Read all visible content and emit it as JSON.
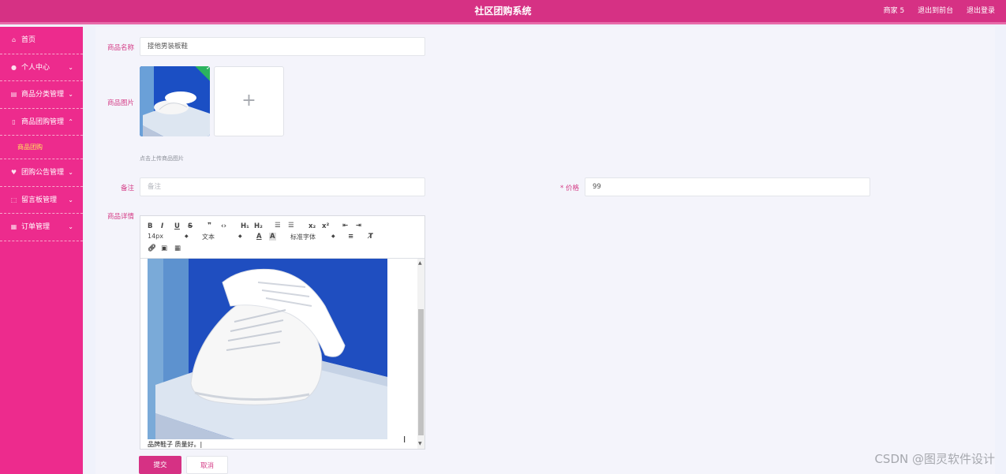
{
  "header": {
    "title": "社区团购系统",
    "user": "商家 5",
    "link_front": "退出到前台",
    "link_logout": "退出登录"
  },
  "sidebar": {
    "items": [
      {
        "label": "首页",
        "icon": "home-icon"
      },
      {
        "label": "个人中心",
        "icon": "user-icon",
        "expanded": false
      },
      {
        "label": "商品分类管理",
        "icon": "category-icon",
        "expanded": false
      },
      {
        "label": "商品团购管理",
        "icon": "goods-icon",
        "expanded": true
      },
      {
        "label": "商品团购",
        "sub": true,
        "active": true
      },
      {
        "label": "团购公告管理",
        "icon": "notice-icon",
        "expanded": false
      },
      {
        "label": "留言板管理",
        "icon": "message-icon",
        "expanded": false
      },
      {
        "label": "订单管理",
        "icon": "order-icon",
        "expanded": false
      }
    ]
  },
  "form": {
    "name_label": "商品名称",
    "name_value": "接他男装板鞋",
    "image_label": "商品图片",
    "upload_hint": "点击上传商品图片",
    "remark_label": "备注",
    "remark_placeholder": "备注",
    "price_label": "* 价格",
    "price_value": "99",
    "detail_label": "商品详情",
    "detail_text": "品牌鞋子 质量好。|"
  },
  "editor_toolbar": {
    "font_size": "14px",
    "block_type": "文本",
    "font_family": "标准字体"
  },
  "buttons": {
    "submit": "提交",
    "cancel": "取消"
  },
  "watermark": "CSDN @图灵软件设计",
  "colors": {
    "header": "#d63184",
    "sidebar": "#ed2b8d",
    "active_sub": "#ffe35a",
    "label": "#d43c86"
  }
}
